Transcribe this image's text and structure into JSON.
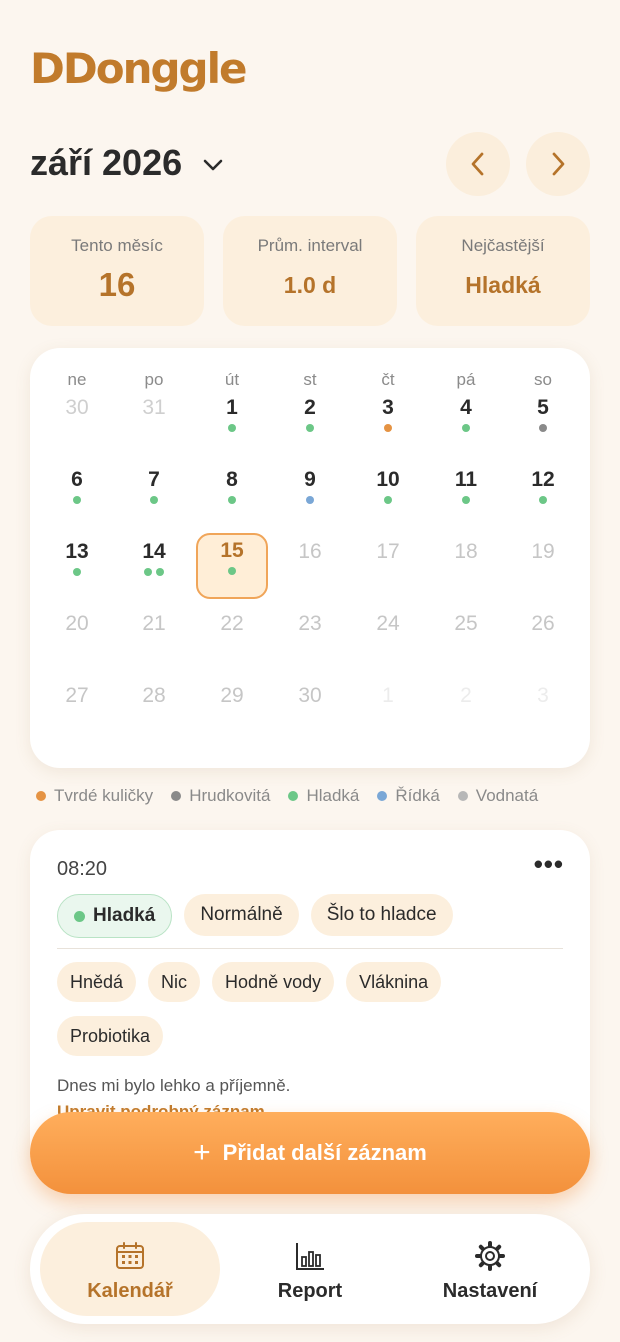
{
  "app": {
    "logo": "DDonggle"
  },
  "header": {
    "month": "září 2026"
  },
  "stats": [
    {
      "label": "Tento měsíc",
      "value": "16"
    },
    {
      "label": "Prům. interval",
      "value": "1.0 d"
    },
    {
      "label": "Nejčastější",
      "value": "Hladká"
    }
  ],
  "colors": {
    "tvrde": "#e59343",
    "hrudkovita": "#8a8a8a",
    "hladka": "#6cc787",
    "ridka": "#7aa7d6",
    "vodnata": "#b7b7b7",
    "accent": "#c17b2c",
    "button": "#f5973f"
  },
  "calendar": {
    "weekdays": [
      "ne",
      "po",
      "út",
      "st",
      "čt",
      "pá",
      "so"
    ],
    "weeks": [
      [
        {
          "d": "30",
          "state": "dim",
          "dots": []
        },
        {
          "d": "31",
          "state": "dim",
          "dots": []
        },
        {
          "d": "1",
          "state": "normal",
          "dots": [
            "hladka"
          ]
        },
        {
          "d": "2",
          "state": "normal",
          "dots": [
            "hladka"
          ]
        },
        {
          "d": "3",
          "state": "normal",
          "dots": [
            "tvrde"
          ]
        },
        {
          "d": "4",
          "state": "normal",
          "dots": [
            "hladka"
          ]
        },
        {
          "d": "5",
          "state": "normal",
          "dots": [
            "hrudkovita"
          ]
        }
      ],
      [
        {
          "d": "6",
          "state": "normal",
          "dots": [
            "hladka"
          ]
        },
        {
          "d": "7",
          "state": "normal",
          "dots": [
            "hladka"
          ]
        },
        {
          "d": "8",
          "state": "normal",
          "dots": [
            "hladka"
          ]
        },
        {
          "d": "9",
          "state": "normal",
          "dots": [
            "ridka"
          ]
        },
        {
          "d": "10",
          "state": "normal",
          "dots": [
            "hladka"
          ]
        },
        {
          "d": "11",
          "state": "normal",
          "dots": [
            "hladka"
          ]
        },
        {
          "d": "12",
          "state": "normal",
          "dots": [
            "hladka"
          ]
        }
      ],
      [
        {
          "d": "13",
          "state": "normal",
          "dots": [
            "hladka"
          ]
        },
        {
          "d": "14",
          "state": "normal",
          "dots": [
            "hladka",
            "hladka"
          ]
        },
        {
          "d": "15",
          "state": "today",
          "dots": [
            "hladka"
          ]
        },
        {
          "d": "16",
          "state": "future",
          "dots": []
        },
        {
          "d": "17",
          "state": "future",
          "dots": []
        },
        {
          "d": "18",
          "state": "future",
          "dots": []
        },
        {
          "d": "19",
          "state": "future",
          "dots": []
        }
      ],
      [
        {
          "d": "20",
          "state": "future",
          "dots": []
        },
        {
          "d": "21",
          "state": "future",
          "dots": []
        },
        {
          "d": "22",
          "state": "future",
          "dots": []
        },
        {
          "d": "23",
          "state": "future",
          "dots": []
        },
        {
          "d": "24",
          "state": "future",
          "dots": []
        },
        {
          "d": "25",
          "state": "future",
          "dots": []
        },
        {
          "d": "26",
          "state": "future",
          "dots": []
        }
      ],
      [
        {
          "d": "27",
          "state": "future",
          "dots": []
        },
        {
          "d": "28",
          "state": "future",
          "dots": []
        },
        {
          "d": "29",
          "state": "future",
          "dots": []
        },
        {
          "d": "30",
          "state": "future",
          "dots": []
        },
        {
          "d": "1",
          "state": "faint",
          "dots": []
        },
        {
          "d": "2",
          "state": "faint",
          "dots": []
        },
        {
          "d": "3",
          "state": "faint",
          "dots": []
        }
      ]
    ]
  },
  "legend": [
    {
      "key": "tvrde",
      "label": "Tvrdé kuličky"
    },
    {
      "key": "hrudkovita",
      "label": "Hrudkovitá"
    },
    {
      "key": "hladka",
      "label": "Hladká"
    },
    {
      "key": "ridka",
      "label": "Řídká"
    },
    {
      "key": "vodnata",
      "label": "Vodnatá"
    }
  ],
  "entry": {
    "time": "08:20",
    "more": "•••",
    "type": "Hladká",
    "chips1": [
      "Normálně",
      "Šlo to hladce"
    ],
    "chips2": [
      "Hnědá",
      "Nic",
      "Hodně vody",
      "Vláknina"
    ],
    "chips3": [
      "Probiotika"
    ],
    "note": "Dnes mi bylo lehko a příjemně.",
    "edit_link": "Upravit podrobný záznam"
  },
  "add_button": {
    "plus": "+",
    "label": "Přidat další záznam"
  },
  "tabs": [
    {
      "label": "Kalendář",
      "icon": "calendar-icon"
    },
    {
      "label": "Report",
      "icon": "bar-chart-icon"
    },
    {
      "label": "Nastavení",
      "icon": "gear-icon"
    }
  ]
}
